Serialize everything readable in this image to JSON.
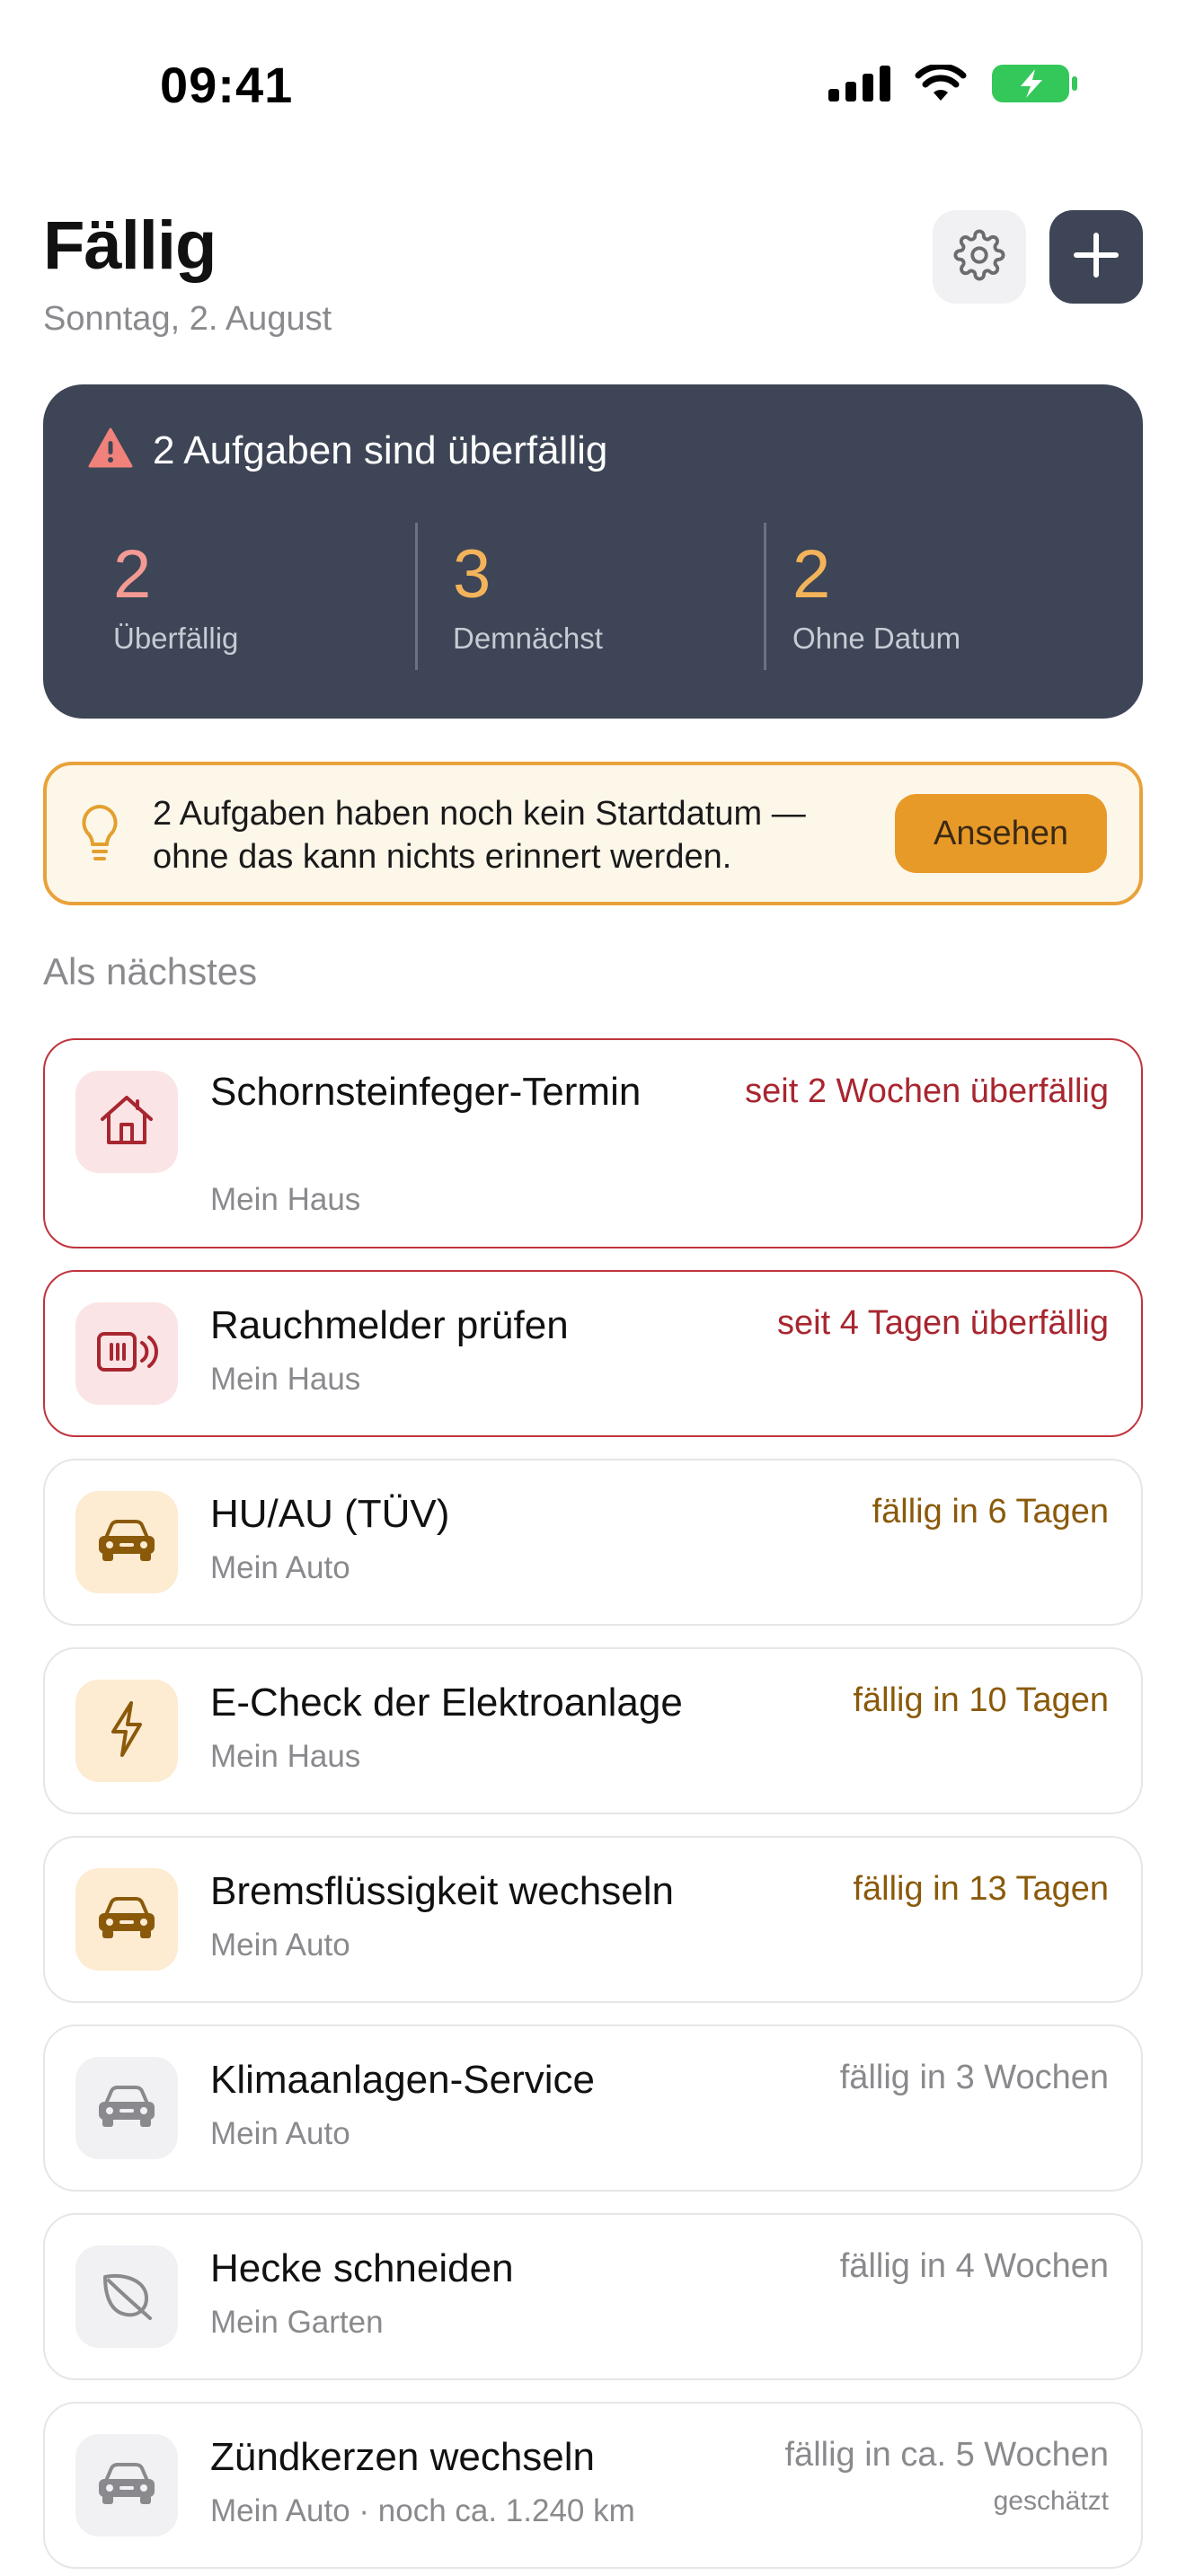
{
  "status_bar": {
    "time": "09:41"
  },
  "header": {
    "title": "Fällig",
    "subtitle": "Sonntag, 2. August"
  },
  "summary": {
    "headline": "2 Aufgaben sind überfällig",
    "stats": [
      {
        "value": "2",
        "label": "Überfällig",
        "color": "#f29a93"
      },
      {
        "value": "3",
        "label": "Demnächst",
        "color": "#f3b35a"
      },
      {
        "value": "2",
        "label": "Ohne Datum",
        "color": "#f3b35a"
      }
    ]
  },
  "hint": {
    "text": "2 Aufgaben haben noch kein Startdatum — ohne das kann nichts erinnert werden.",
    "button_label": "Ansehen"
  },
  "section_title": "Als nächstes",
  "tasks": [
    {
      "title": "Schornsteinfeger-Termin",
      "category": "Mein Haus",
      "due": "seit 2 Wochen überfällig",
      "icon": "house-icon",
      "status": "overdue"
    },
    {
      "title": "Rauchmelder prüfen",
      "category": "Mein Haus",
      "due": "seit 4 Tagen überfällig",
      "icon": "smoke-detector-icon",
      "status": "overdue"
    },
    {
      "title": "HU/AU (TÜV)",
      "category": "Mein Auto",
      "due": "fällig in 6 Tagen",
      "icon": "car-icon",
      "status": "soon"
    },
    {
      "title": "E-Check der Elektroanlage",
      "category": "Mein Haus",
      "due": "fällig in 10 Tagen",
      "icon": "lightning-icon",
      "status": "soon"
    },
    {
      "title": "Bremsflüssigkeit wechseln",
      "category": "Mein Auto",
      "due": "fällig in 13 Tagen",
      "icon": "car-icon",
      "status": "soon"
    },
    {
      "title": "Klimaanlagen-Service",
      "category": "Mein Auto",
      "due": "fällig in 3 Wochen",
      "icon": "car-icon",
      "status": "later"
    },
    {
      "title": "Hecke schneiden",
      "category": "Mein Garten",
      "due": "fällig in 4 Wochen",
      "icon": "leaf-icon",
      "status": "later"
    },
    {
      "title": "Zündkerzen wechseln",
      "category": "Mein Auto · noch ca. 1.240 km",
      "due": "fällig in ca. 5 Wochen",
      "due_note": "geschätzt",
      "icon": "car-icon",
      "status": "later"
    }
  ],
  "colors": {
    "overdue_text": "#a8262f",
    "soon_text": "#8a5a0a",
    "later_text": "#8a8a8e",
    "overdue_icon_bg": "#fbe4e5",
    "soon_icon_bg": "#fdebd2",
    "later_icon_bg": "#f1f1f4",
    "card_dark": "#3d4556",
    "accent_orange": "#e89a28"
  }
}
